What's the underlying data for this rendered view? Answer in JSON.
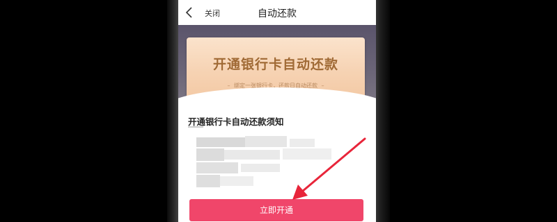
{
  "navbar": {
    "back_icon": "chevron-left-icon",
    "close_label": "关闭",
    "title": "自动还款"
  },
  "banner": {
    "title": "开通银行卡自动还款",
    "subtitle": "绑定一张银行卡，还款日自动还款",
    "subtitle_dash": "–"
  },
  "notice": {
    "title": "开通银行卡自动还款须知"
  },
  "action": {
    "button_label": "立即开通"
  },
  "colors": {
    "button": "#f0466a",
    "banner_text": "#a06a35",
    "arrow": "#e8253a"
  }
}
